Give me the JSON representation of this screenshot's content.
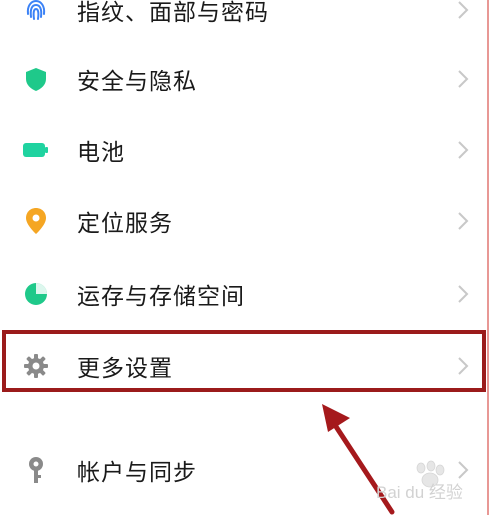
{
  "settings": {
    "items": [
      {
        "label": "指纹、面部与密码",
        "icon": "fingerprint-icon",
        "color": "#3b82f6"
      },
      {
        "label": "安全与隐私",
        "icon": "shield-icon",
        "color": "#1fc98a"
      },
      {
        "label": "电池",
        "icon": "battery-icon",
        "color": "#1fd3a0"
      },
      {
        "label": "定位服务",
        "icon": "location-pin-icon",
        "color": "#f5a623"
      },
      {
        "label": "运存与存储空间",
        "icon": "pie-chart-icon",
        "color": "#1fc98a"
      },
      {
        "label": "更多设置",
        "icon": "gear-icon",
        "color": "#8a8a8a"
      },
      {
        "label": "帐户与同步",
        "icon": "key-icon",
        "color": "#8a8a8a"
      }
    ]
  },
  "annotation": {
    "highlight_color": "#9b1b1b",
    "arrow_color": "#a5191c"
  },
  "watermark": {
    "text": "Bai du 经验"
  }
}
